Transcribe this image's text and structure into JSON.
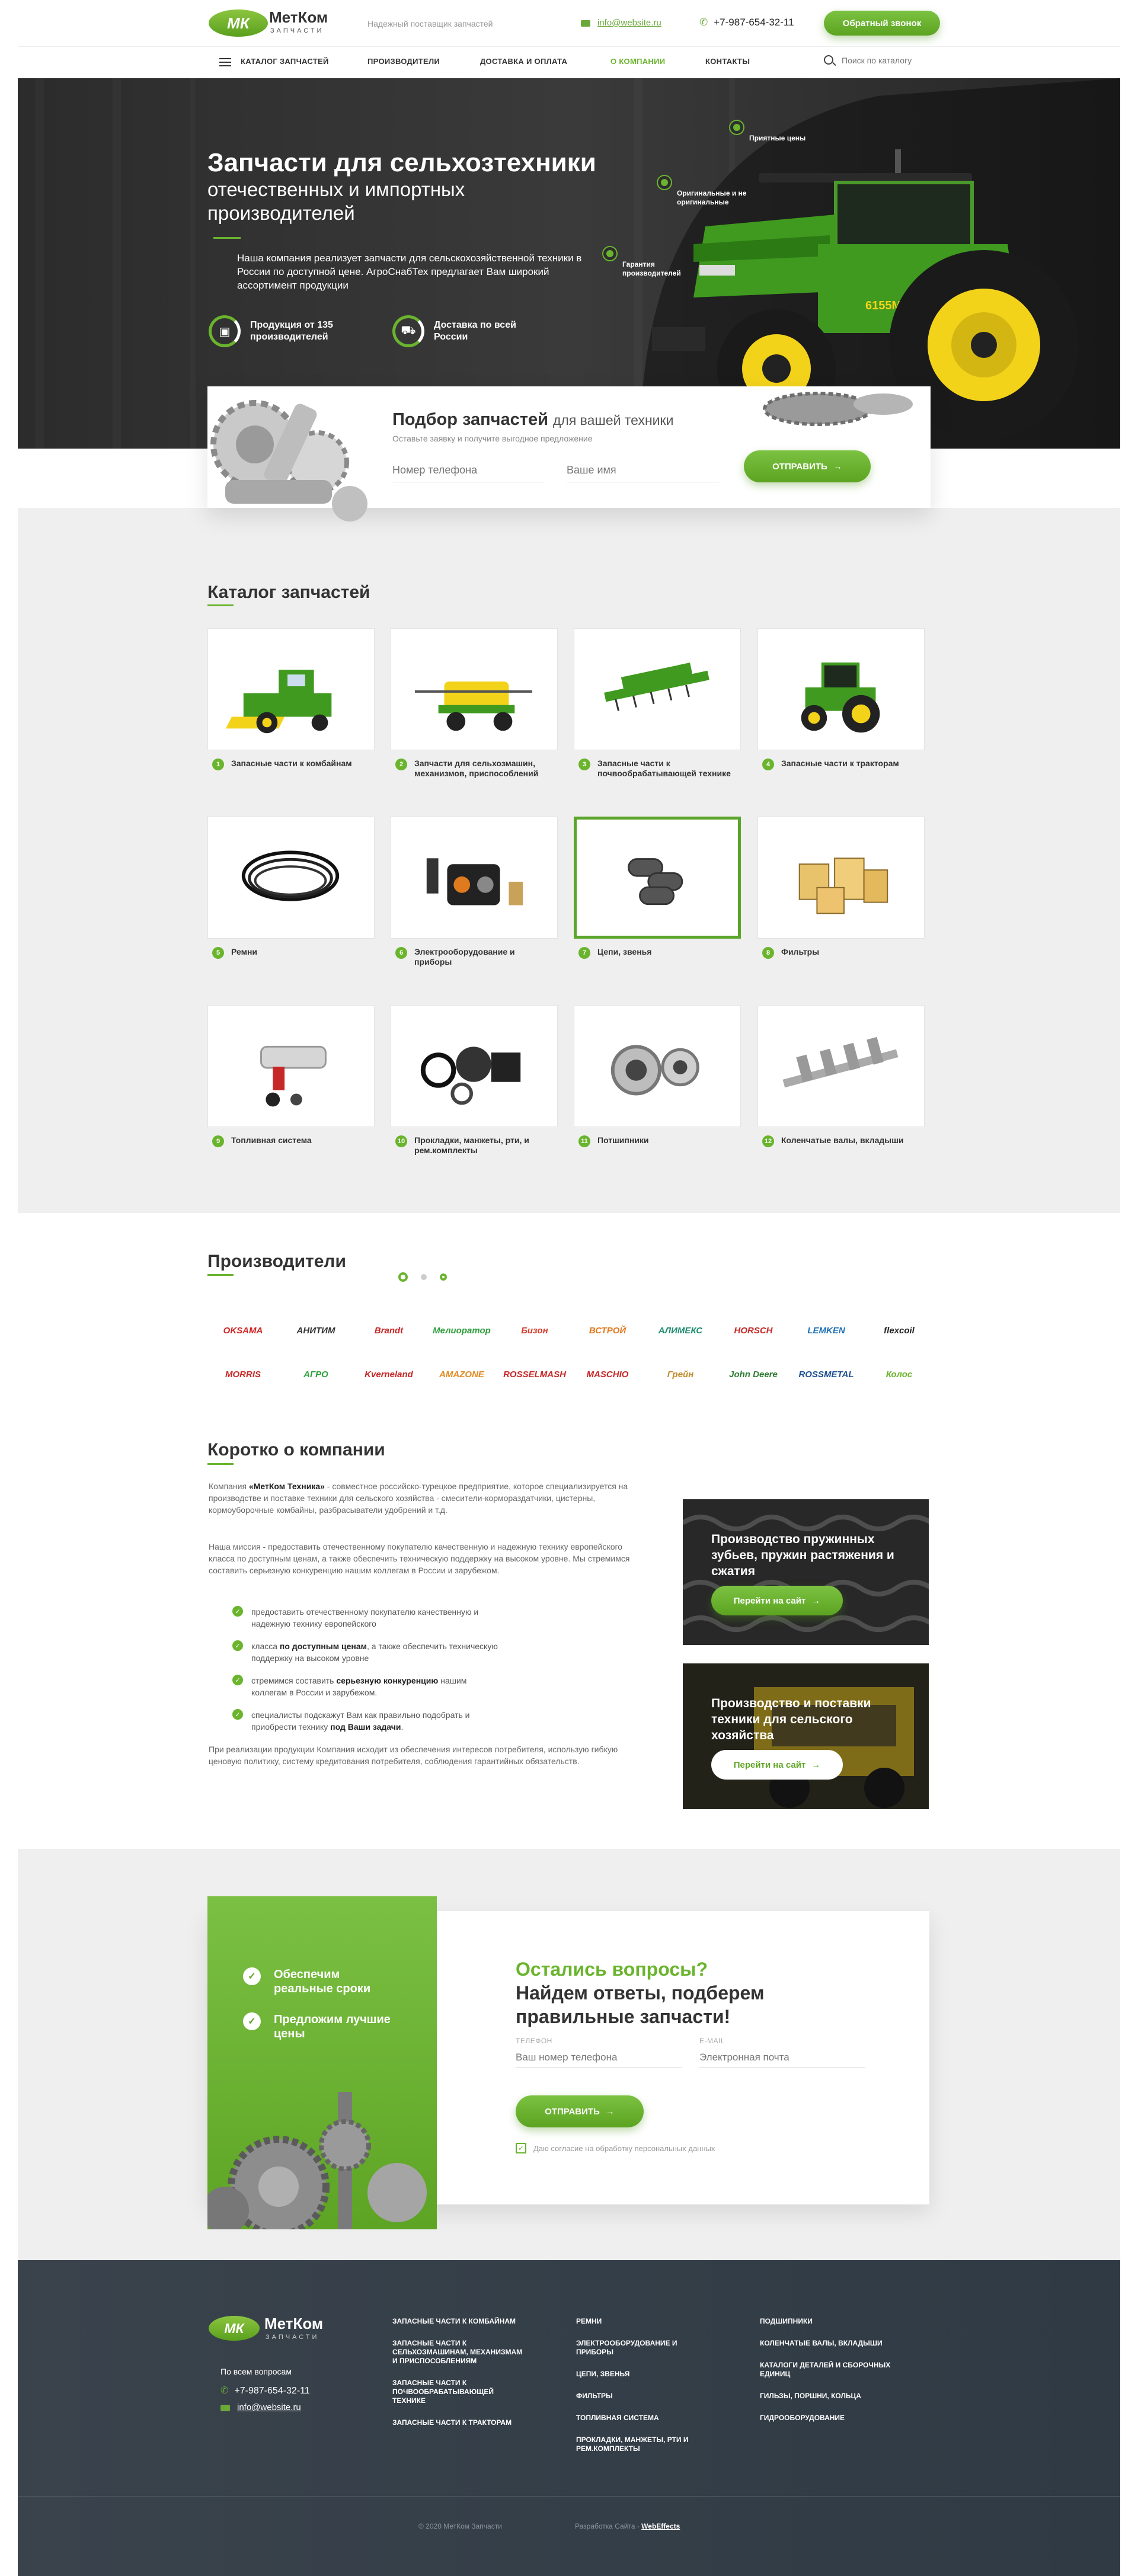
{
  "header": {
    "logo_mark": "МК",
    "logo_name": "МетКом",
    "logo_sub": "ЗАПЧАСТИ",
    "tagline": "Надежный поставщик запчастей",
    "email": "info@website.ru",
    "phone": "+7-987-654-32-11",
    "callback_label": "Обратный звонок"
  },
  "nav": {
    "catalog": "КАТАЛОГ ЗАПЧАСТЕЙ",
    "items": [
      "ПРОИЗВОДИТЕЛИ",
      "ДОСТАВКА И ОПЛАТА",
      "О КОМПАНИИ",
      "КОНТАКТЫ"
    ],
    "active_index": 2,
    "search_placeholder": "Поиск по каталогу"
  },
  "hero": {
    "title": "Запчасти для сельхозтехники",
    "subtitle": "отечественных и импортных производителей",
    "description": "Наша компания реализует запчасти для сельскохозяйственной техники в России по доступной цене. АгроСнабТех предлагает Вам широкий ассортимент продукции",
    "features": [
      "Продукция от 135 производителей",
      "Доставка по всей России"
    ],
    "callouts": [
      "Приятные цены",
      "Оригинальные и не оригинальные",
      "Гарантия производителей"
    ]
  },
  "request": {
    "title_bold": "Подбор запчастей",
    "title_rest": "для вашей техники",
    "subtitle": "Оставьте заявку и получите выгодное предложение",
    "phone_placeholder": "Номер телефона",
    "name_placeholder": "Ваше имя",
    "button": "ОТПРАВИТЬ"
  },
  "catalog": {
    "title": "Каталог запчастей",
    "items": [
      {
        "num": "1",
        "label": "Запасные части к комбайнам",
        "icon": "combine-harvester"
      },
      {
        "num": "2",
        "label": "Запчасти для сельхозмашин, механизмов, приспособлений",
        "icon": "sprayer"
      },
      {
        "num": "3",
        "label": "Запасные части к почвообрабатывающей технике",
        "icon": "seeder"
      },
      {
        "num": "4",
        "label": "Запасные части к тракторам",
        "icon": "tractor"
      },
      {
        "num": "5",
        "label": "Ремни",
        "icon": "belts"
      },
      {
        "num": "6",
        "label": "Электрооборудование и приборы",
        "icon": "electrical"
      },
      {
        "num": "7",
        "label": "Цепи, звенья",
        "icon": "chain"
      },
      {
        "num": "8",
        "label": "Фильтры",
        "icon": "filters"
      },
      {
        "num": "9",
        "label": "Топливная система",
        "icon": "fuel-pump"
      },
      {
        "num": "10",
        "label": "Прокладки, манжеты, рти, и рем.комплекты",
        "icon": "gaskets"
      },
      {
        "num": "11",
        "label": "Потшипники",
        "icon": "bearings"
      },
      {
        "num": "12",
        "label": "Коленчатые валы, вкладыши",
        "icon": "crankshaft"
      }
    ],
    "active_index": 6
  },
  "producers": {
    "title": "Производители",
    "brands": [
      {
        "name": "OKSAMA",
        "color": "#d22323"
      },
      {
        "name": "АНИТИМ",
        "color": "#333333"
      },
      {
        "name": "Brandt",
        "color": "#c62828"
      },
      {
        "name": "Мелиоратор",
        "color": "#2e9e3c"
      },
      {
        "name": "Бизон",
        "color": "#d33b2a"
      },
      {
        "name": "ВСТРОЙ",
        "color": "#e07a1f"
      },
      {
        "name": "АЛИМЕКС",
        "color": "#1d8a6c"
      },
      {
        "name": "HORSCH",
        "color": "#c62828"
      },
      {
        "name": "LEMKEN",
        "color": "#1b6fb3"
      },
      {
        "name": "flexcoil",
        "color": "#222222"
      },
      {
        "name": "MORRIS",
        "color": "#c62828"
      },
      {
        "name": "АГРО",
        "color": "#2e9e3c"
      },
      {
        "name": "Kverneland",
        "color": "#c62828"
      },
      {
        "name": "AMAZONE",
        "color": "#e08a1f"
      },
      {
        "name": "ROSSELMASH",
        "color": "#c62828"
      },
      {
        "name": "MASCHIO",
        "color": "#c62828"
      },
      {
        "name": "Грейн",
        "color": "#c08a2a"
      },
      {
        "name": "John Deere",
        "color": "#2e7d32"
      },
      {
        "name": "ROSSMETAL",
        "color": "#1d4f91"
      },
      {
        "name": "Колос",
        "color": "#6ab42e"
      }
    ]
  },
  "about": {
    "title": "Коротко о компании",
    "p1_start": "Компания ",
    "p1_bold": "«МетКом Техника»",
    "p1_rest": " - совместное российско-турецкое предприятие, которое специализируется на производстве и поставке техники для сельского хозяйства - смесители-кормораздатчики, цистерны, кормоуборочные комбайны, разбрасыватели удобрений и т.д.",
    "p2": "Наша миссия - предоставить отечественному покупателю качественную и надежную технику европейского класса по доступным ценам, а также обеспечить техническую поддержку на высоком уровне. Мы стремимся составить серьезную конкуренцию нашим коллегам в России и зарубежом.",
    "checks": [
      {
        "a": "предоставить отечественному покупателю качественную и надежную технику европейского",
        "b": "",
        "c": ""
      },
      {
        "a": "класса ",
        "b": "по доступным ценам",
        "c": ", а также обеспечить техническую поддержку на высоком уровне"
      },
      {
        "a": "стремимся составить ",
        "b": "серьезную конкуренцию",
        "c": " нашим коллегам в России и зарубежом."
      },
      {
        "a": "специалисты подскажут Вам как правильно подобрать и приобрести технику ",
        "b": "под Ваши задачи",
        "c": "."
      }
    ],
    "p3": "При реализации продукции Компания исходит из обеспечения интересов потребителя, использую гибкую ценовую политику, систему кредитования потребителя, соблюдения гарантийных обязательств.",
    "promos": [
      {
        "title": "Производство пружинных зубьев, пружин растяжения и сжатия",
        "button": "Перейти на сайт"
      },
      {
        "title": "Производство и поставки техники для сельского хозяйства",
        "button": "Перейти на сайт"
      }
    ]
  },
  "contact": {
    "benefits": [
      "Обеспечим реальные сроки",
      "Предложим лучшие цены"
    ],
    "q1": "Остались вопросы?",
    "q2": "Найдем ответы, подберем правильные запчасти!",
    "phone_label": "ТЕЛЕФОН",
    "phone_placeholder": "Ваш номер телефона",
    "email_label": "E-MAIL",
    "email_placeholder": "Электронная почта",
    "button": "ОТПРАВИТЬ",
    "agree": "Даю согласие на обработку персональных данных"
  },
  "footer": {
    "questions": "По всем вопросам",
    "phone": "+7-987-654-32-11",
    "email": "info@website.ru",
    "col1": [
      "ЗАПАСНЫЕ ЧАСТИ К КОМБАЙНАМ",
      "ЗАПАСНЫЕ ЧАСТИ К СЕЛЬХОЗМАШИНАМ, МЕХАНИЗМАМ И ПРИСПОСОБЛЕНИЯМ",
      "ЗАПАСНЫЕ ЧАСТИ К ПОЧВООБРАБАТЫВАЮЩЕЙ ТЕХНИКЕ",
      "ЗАПАСНЫЕ ЧАСТИ К ТРАКТОРАМ"
    ],
    "col2": [
      "РЕМНИ",
      "ЭЛЕКТРООБОРУДОВАНИЕ И ПРИБОРЫ",
      "ЦЕПИ, ЗВЕНЬЯ",
      "ФИЛЬТРЫ",
      "ТОПЛИВНАЯ СИСТЕМА",
      "ПРОКЛАДКИ, МАНЖЕТЫ, РТИ И РЕМ.КОМПЛЕКТЫ"
    ],
    "col3": [
      "ПОДШИПНИКИ",
      "КОЛЕНЧАТЫЕ ВАЛЫ, ВКЛАДЫШИ",
      "КАТАЛОГИ ДЕТАЛЕЙ И СБОРОЧНЫХ ЕДИНИЦ",
      "ГИЛЬЗЫ, ПОРШНИ, КОЛЬЦА",
      "ГИДРООБОРУДОВАНИЕ"
    ],
    "copyright": "© 2020 МетКом Запчасти",
    "dev_label": "Разработка Сайта - ",
    "dev_name": "WebEffects"
  },
  "colors": {
    "accent": "#6ab42e",
    "dark": "#333333",
    "footer": "#36404a"
  }
}
